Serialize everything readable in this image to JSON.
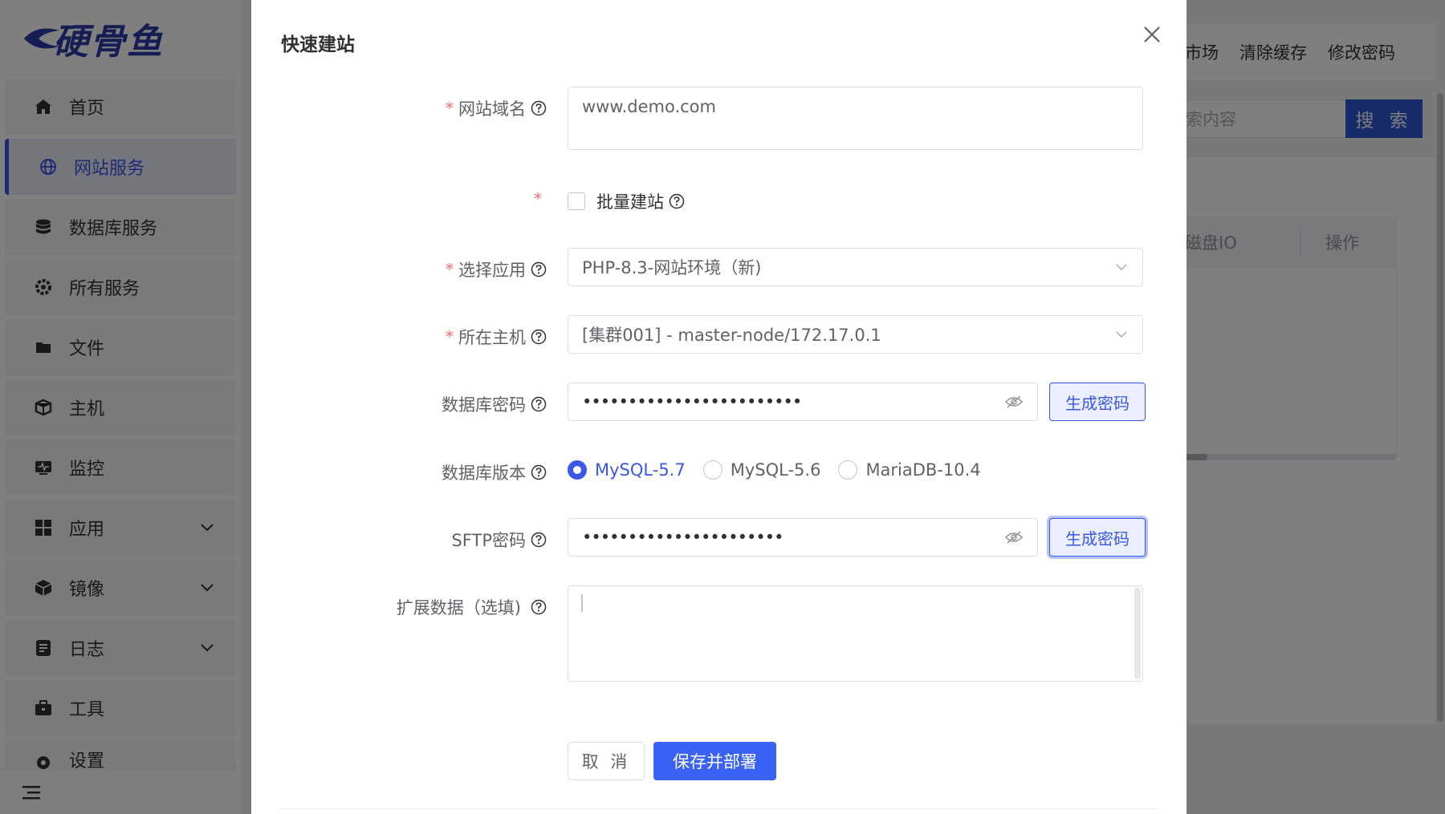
{
  "app": {
    "logo_text": "硬骨鱼",
    "sidebar": {
      "items": [
        {
          "label": "首页",
          "icon": "home-icon"
        },
        {
          "label": "网站服务",
          "icon": "globe-icon",
          "active": true
        },
        {
          "label": "数据库服务",
          "icon": "database-icon"
        },
        {
          "label": "所有服务",
          "icon": "services-icon"
        },
        {
          "label": "文件",
          "icon": "folder-icon"
        },
        {
          "label": "主机",
          "icon": "host-icon"
        },
        {
          "label": "监控",
          "icon": "monitor-icon"
        },
        {
          "label": "应用",
          "icon": "apps-icon",
          "expandable": true
        },
        {
          "label": "镜像",
          "icon": "image-icon",
          "expandable": true
        },
        {
          "label": "日志",
          "icon": "log-icon",
          "expandable": true
        },
        {
          "label": "工具",
          "icon": "toolbox-icon"
        },
        {
          "label": "设置",
          "icon": "settings-icon"
        }
      ]
    },
    "topbar": {
      "links": [
        "市场",
        "清除缓存",
        "修改密码"
      ]
    },
    "search": {
      "placeholder": "索内容",
      "button": "搜 索"
    },
    "table": {
      "headers": [
        "磁盘IO",
        "操作"
      ]
    }
  },
  "dialog": {
    "title": "快速建站",
    "fields": {
      "domain": {
        "label": "网站域名",
        "value": "www.demo.com",
        "required": true
      },
      "batch": {
        "label": "批量建站",
        "required": true,
        "checked": false
      },
      "app": {
        "label": "选择应用",
        "value": "PHP-8.3-网站环境（新)",
        "required": true
      },
      "host": {
        "label": "所在主机",
        "value": "[集群001] - master-node/172.17.0.1",
        "required": true
      },
      "db_password": {
        "label": "数据库密码",
        "value": "••••••••••••••••••••••••",
        "button": "生成密码"
      },
      "db_version": {
        "label": "数据库版本",
        "options": [
          "MySQL-5.7",
          "MySQL-5.6",
          "MariaDB-10.4"
        ],
        "selected": "MySQL-5.7"
      },
      "sftp_password": {
        "label": "SFTP密码",
        "value": "••••••••••••••••••••••",
        "button": "生成密码"
      },
      "ext_data": {
        "label": "扩展数据（选填)",
        "value": ""
      }
    },
    "buttons": {
      "cancel": "取 消",
      "save": "保存并部署"
    }
  },
  "colors": {
    "primary": "#3a57e8",
    "required": "#f56c6c",
    "overlay": "rgba(0,0,0,0.5)"
  }
}
